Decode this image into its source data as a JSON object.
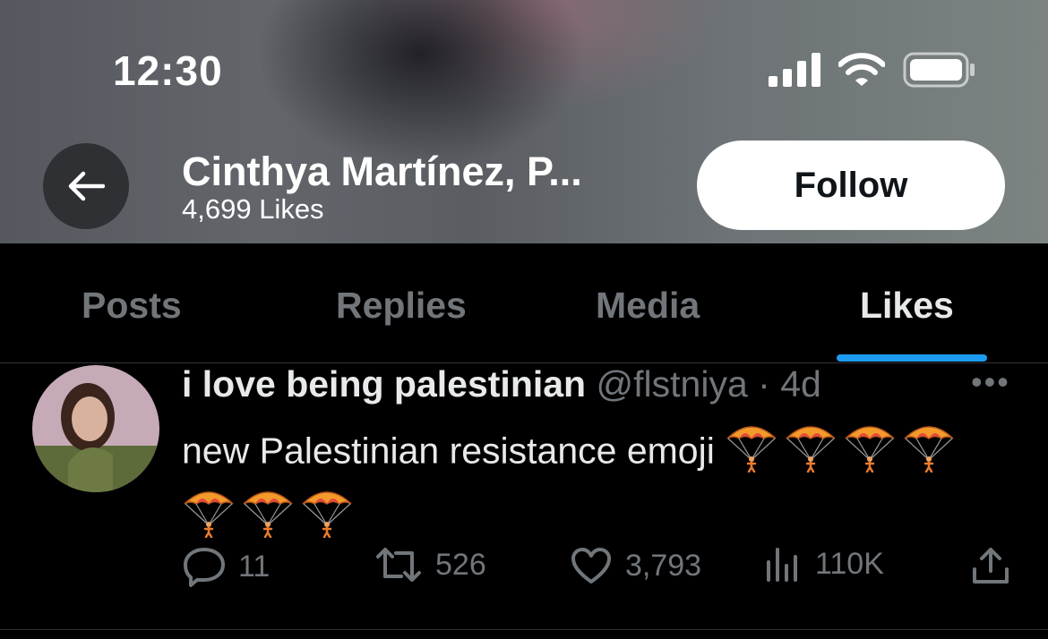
{
  "status_bar": {
    "time": "12:30",
    "icons": [
      "signal-icon",
      "wifi-icon",
      "battery-icon"
    ]
  },
  "profile": {
    "name": "Cinthya Martínez, P...",
    "likes_count": "4,699 Likes",
    "follow_label": "Follow"
  },
  "tabs": [
    {
      "label": "Posts"
    },
    {
      "label": "Replies"
    },
    {
      "label": "Media"
    },
    {
      "label": "Likes",
      "active": true
    }
  ],
  "post": {
    "author": "i love being palestinian",
    "handle": "@flstniya",
    "separator": "·",
    "time": "4d",
    "text": "new Palestinian resistance emoji",
    "emoji": "parachute",
    "emoji_count": 7,
    "actions": {
      "replies": "11",
      "reposts": "526",
      "likes": "3,793",
      "views": "110K"
    }
  },
  "colors": {
    "accent": "#1d9bf0",
    "muted": "#71767b",
    "text": "#e7e9ea",
    "background": "#000000"
  }
}
